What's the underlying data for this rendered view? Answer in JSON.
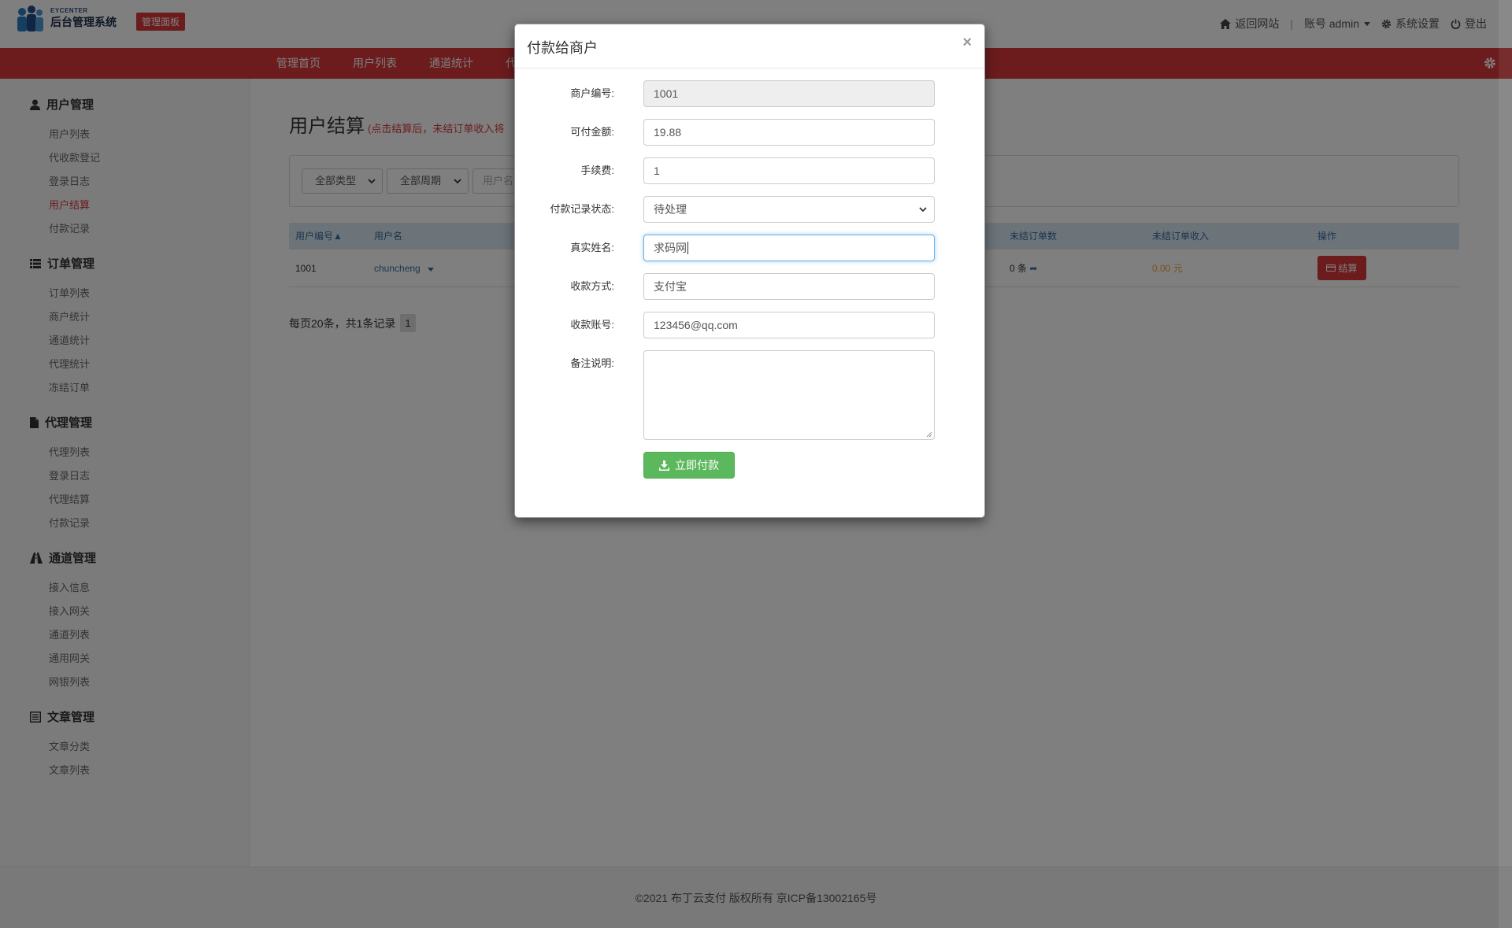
{
  "header": {
    "logo_small": "EYCENTER",
    "logo_big": "后台管理系统",
    "badge": "管理面板",
    "links": {
      "home": "返回网站",
      "account": "账号 admin",
      "settings": "系统设置",
      "logout": "登出"
    }
  },
  "nav": {
    "items": [
      "管理首页",
      "用户列表",
      "通道统计",
      "代"
    ]
  },
  "sidebar": {
    "sections": [
      {
        "title": "用户管理",
        "icon": "user-icon",
        "items": [
          "用户列表",
          "代收款登记",
          "登录日志",
          "用户结算",
          "付款记录"
        ],
        "active": "用户结算"
      },
      {
        "title": "订单管理",
        "icon": "list-icon",
        "items": [
          "订单列表",
          "商户统计",
          "通道统计",
          "代理统计",
          "冻结订单"
        ]
      },
      {
        "title": "代理管理",
        "icon": "file-icon",
        "items": [
          "代理列表",
          "登录日志",
          "代理结算",
          "付款记录"
        ]
      },
      {
        "title": "通道管理",
        "icon": "road-icon",
        "items": [
          "接入信息",
          "接入网关",
          "通道列表",
          "通用网关",
          "网银列表"
        ]
      },
      {
        "title": "文章管理",
        "icon": "article-icon",
        "items": [
          "文章分类",
          "文章列表"
        ]
      }
    ]
  },
  "main": {
    "title": "用户结算",
    "hint": "(点击结算后，未结订单收入将",
    "filters": {
      "type": "全部类型",
      "period": "全部周期",
      "user_placeholder": "用户名"
    },
    "table": {
      "headers": [
        "用户编号",
        "用户名",
        "未结订单数",
        "未结订单收入",
        "操作"
      ],
      "rows": [
        {
          "id": "1001",
          "name": "chuncheng",
          "unsettled_count": "0 条",
          "unsettled_income": "0.00 元",
          "action": "结算"
        }
      ]
    },
    "pager": {
      "summary": "每页20条，共1条记录",
      "page": "1"
    }
  },
  "footer": {
    "text": "©2021  布丁云支付 版权所有  京ICP备13002165号"
  },
  "modal": {
    "title": "付款给商户",
    "close": "×",
    "fields": [
      {
        "label": "商户编号:",
        "value": "1001"
      },
      {
        "label": "可付金额:",
        "value": "19.88"
      },
      {
        "label": "手续费:",
        "value": "1"
      },
      {
        "label": "付款记录状态:",
        "value": "待处理"
      },
      {
        "label": "真实姓名:",
        "value": "求码网"
      },
      {
        "label": "收款方式:",
        "value": "支付宝"
      },
      {
        "label": "收款账号:",
        "value": "123456@qq.com"
      },
      {
        "label": "备注说明:",
        "value": ""
      }
    ],
    "submit": "立即付款"
  },
  "colors": {
    "brand_red": "#d9383a",
    "success_green": "#5cb85c",
    "table_head": "#d9e8f5"
  }
}
